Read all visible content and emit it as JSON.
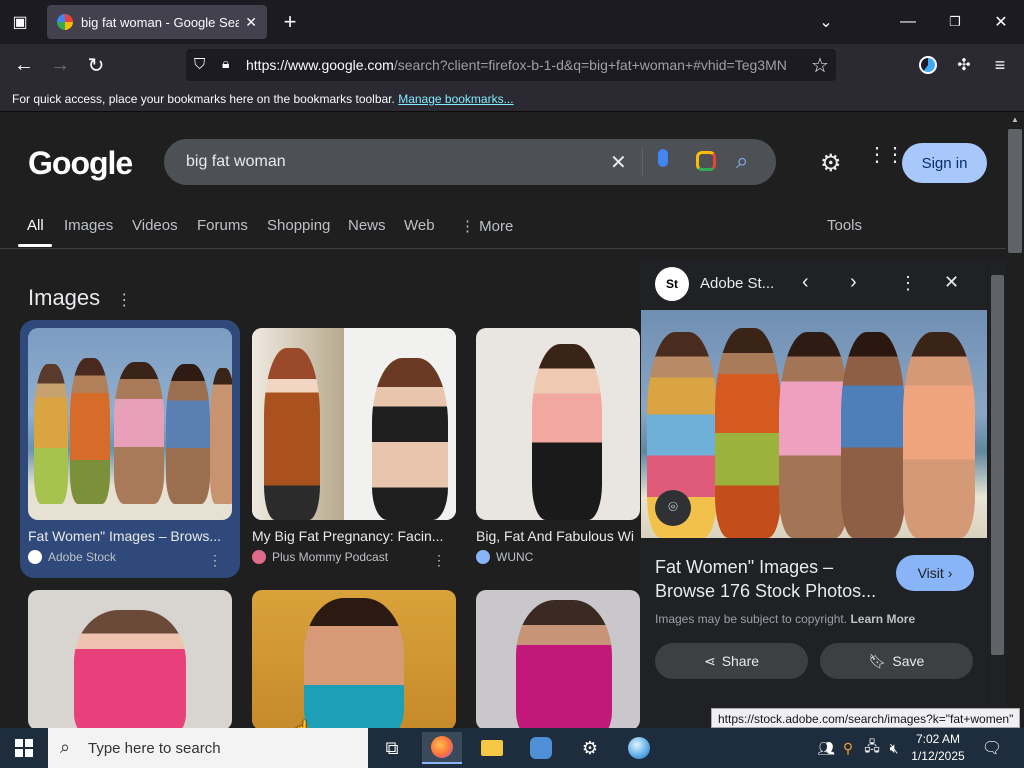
{
  "browser": {
    "tab_title": "big fat woman - Google Search",
    "new_tab_label": "+",
    "url_host": "https://www.google.com",
    "url_rest": "/search?client=firefox-b-1-d&q=big+fat+woman+#vhid=Teg3MN",
    "bookmarks_text": "For quick access, place your bookmarks here on the bookmarks toolbar.",
    "bookmarks_link": "Manage bookmarks..."
  },
  "google": {
    "logo": "Google",
    "query": "big fat woman",
    "sign_in": "Sign in",
    "tabs": [
      "All",
      "Images",
      "Videos",
      "Forums",
      "Shopping",
      "News",
      "Web",
      "More"
    ],
    "tools": "Tools",
    "images_heading": "Images"
  },
  "results": [
    {
      "caption": "Fat Women\" Images – Brows...",
      "source": "Adobe Stock",
      "source_color": "#ffffff"
    },
    {
      "caption": "My Big Fat Pregnancy: Facin...",
      "source": "Plus Mommy Podcast",
      "source_color": "#e06a8a"
    },
    {
      "caption": "Big, Fat And Fabulous Wi",
      "source": "WUNC",
      "source_color": "#8ab4f8"
    }
  ],
  "panel": {
    "source_name": "Adobe St...",
    "logo_text": "St",
    "title": "Fat Women\" Images – Browse 176 Stock Photos...",
    "visit": "Visit",
    "copyright": "Images may be subject to copyright.",
    "learn_more": "Learn More",
    "share": "Share",
    "save": "Save"
  },
  "status_url": "https://stock.adobe.com/search/images?k=\"fat+women\"",
  "taskbar": {
    "search_placeholder": "Type here to search",
    "time": "7:02 AM",
    "date": "1/12/2025"
  },
  "colors": {
    "accent_blue": "#8ab4f8",
    "signin_bg": "#a8c7fa",
    "selected_card": "#2f4a7a"
  }
}
